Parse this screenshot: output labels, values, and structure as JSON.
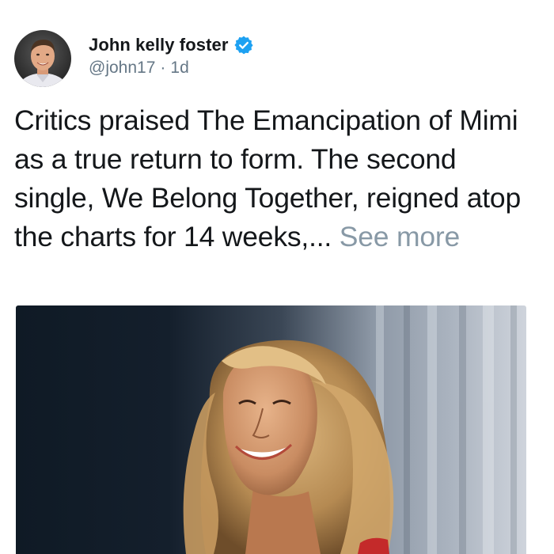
{
  "tweet": {
    "author": {
      "display_name": "John kelly foster",
      "handle": "@john17",
      "verified": true,
      "avatar_icon": "profile-photo"
    },
    "separator": "·",
    "time": "1d",
    "text": "Critics praised The Emancipation of Mimi as a true return to form. The second single, We Belong Together, reigned atop the charts for 14 weeks,...",
    "see_more": "See more",
    "media": {
      "kind": "photo"
    },
    "colors": {
      "verified_badge": "#1da1f2",
      "secondary_text": "#657786",
      "see_more": "#8899a6",
      "primary_text": "#14171a"
    }
  }
}
